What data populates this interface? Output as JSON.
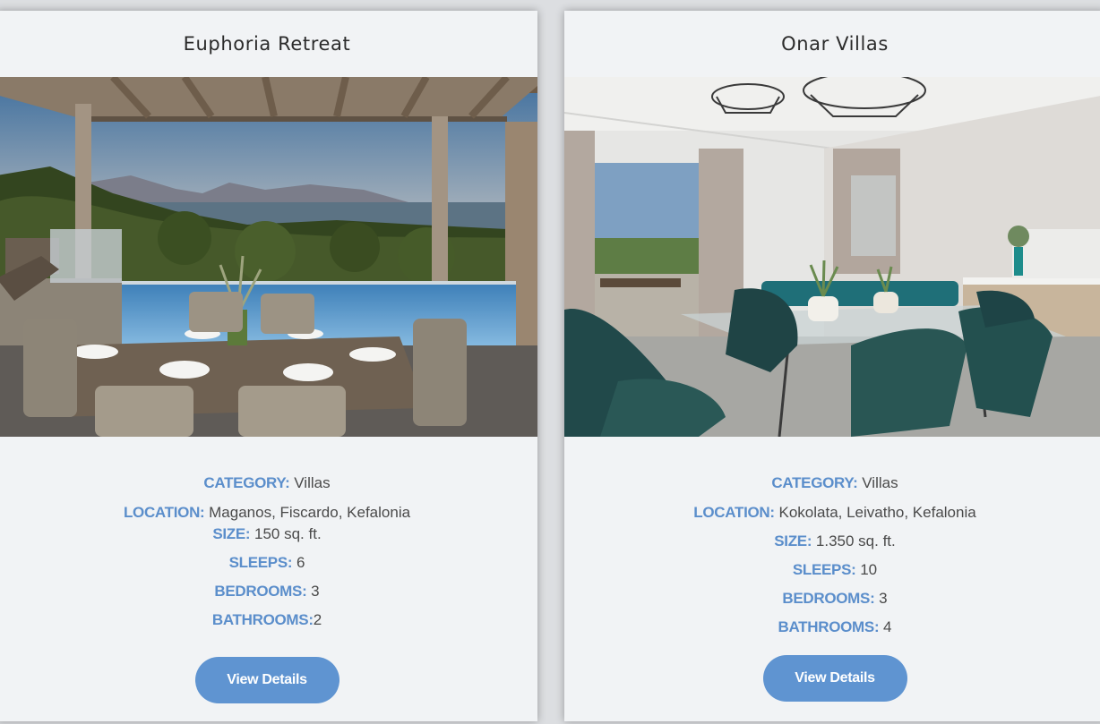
{
  "cards": [
    {
      "title": "Euphoria Retreat",
      "image_alt": "Outdoor dining terrace with infinity pool and sea view at sunset",
      "fields": {
        "category": {
          "label": "CATEGORY:",
          "value": " Villas"
        },
        "location": {
          "label": "LOCATION:",
          "value": " Maganos, Fiscardo, Kefalonia"
        },
        "size": {
          "label": "SIZE:",
          "value": " 150 sq. ft."
        },
        "sleeps": {
          "label": "SLEEPS:",
          "value": " 6"
        },
        "bedrooms": {
          "label": "BEDROOMS:",
          "value": " 3"
        },
        "bathrooms": {
          "label": "BATHROOMS:",
          "value": "2"
        }
      },
      "button_label": "View Details"
    },
    {
      "title": "Onar Villas",
      "image_alt": "Bright dining room with glass table, green chairs and balcony view",
      "fields": {
        "category": {
          "label": "CATEGORY:",
          "value": " Villas"
        },
        "location": {
          "label": "LOCATION:",
          "value": " Kokolata, Leivatho, Kefalonia"
        },
        "size": {
          "label": "SIZE:",
          "value": " 1.350 sq. ft."
        },
        "sleeps": {
          "label": "SLEEPS:",
          "value": " 10"
        },
        "bedrooms": {
          "label": "BEDROOMS:",
          "value": " 3"
        },
        "bathrooms": {
          "label": "BATHROOMS:",
          "value": " 4"
        }
      },
      "button_label": "View Details"
    }
  ],
  "colors": {
    "label": "#5b8ecb",
    "button": "#5f94d1",
    "card_bg": "#f1f3f5",
    "page_bg": "#dcdee1"
  }
}
